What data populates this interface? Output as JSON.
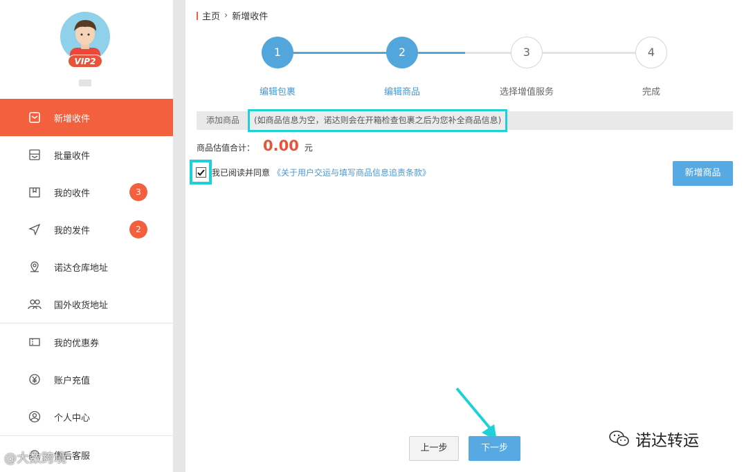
{
  "user": {
    "vip_label": "VIP2"
  },
  "sidebar": {
    "items": [
      {
        "label": "新增收件",
        "icon": "inbox-icon",
        "active": true
      },
      {
        "label": "批量收件",
        "icon": "batch-inbox-icon"
      },
      {
        "label": "我的收件",
        "icon": "package-icon",
        "badge": "3"
      },
      {
        "label": "我的发件",
        "icon": "send-icon",
        "badge": "2"
      },
      {
        "label": "诺达仓库地址",
        "icon": "location-pin-icon"
      },
      {
        "label": "国外收货地址",
        "icon": "users-icon"
      },
      {
        "label": "我的优惠券",
        "icon": "coupon-icon"
      },
      {
        "label": "账户充值",
        "icon": "yen-icon"
      },
      {
        "label": "个人中心",
        "icon": "user-icon"
      },
      {
        "label": "售后客服",
        "icon": "headset-icon"
      }
    ]
  },
  "breadcrumb": {
    "home": "主页",
    "current": "新增收件"
  },
  "steps": [
    {
      "number": "1",
      "label": "编辑包裹",
      "status": "done"
    },
    {
      "number": "2",
      "label": "编辑商品",
      "status": "done"
    },
    {
      "number": "3",
      "label": "选择增值服务",
      "status": "todo"
    },
    {
      "number": "4",
      "label": "完成",
      "status": "todo"
    }
  ],
  "add_goods": {
    "title": "添加商品",
    "hint": "(如商品信息为空，诺达则会在开箱检查包裹之后为您补全商品信息)"
  },
  "total": {
    "label": "商品估值合计：",
    "amount": "0.00",
    "unit": "元"
  },
  "agreement": {
    "checked": true,
    "text": "我已阅读并同意",
    "link": "《关于用户交运与填写商品信息追责条款》"
  },
  "buttons": {
    "add_goods": "新增商品",
    "prev": "上一步",
    "next": "下一步"
  },
  "watermark": {
    "brand": "诺达转运",
    "source": "@大数跨境"
  },
  "colors": {
    "accent": "#f2603d",
    "primary": "#56a9e2",
    "annotation": "#1ed0d8"
  }
}
